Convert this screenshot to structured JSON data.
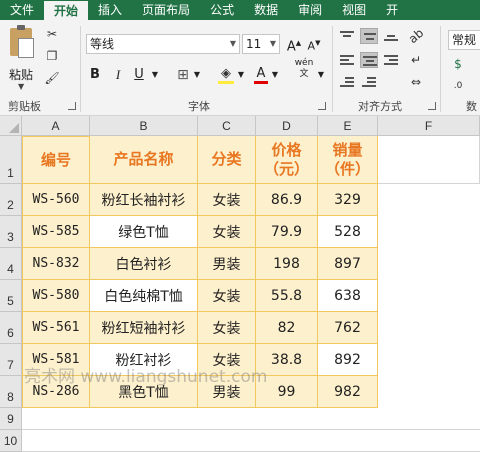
{
  "ribbon_tabs": [
    "文件",
    "开始",
    "插入",
    "页面布局",
    "公式",
    "数据",
    "审阅",
    "视图",
    "开"
  ],
  "active_tab": 1,
  "clipboard": {
    "paste_label": "粘贴",
    "group_label": "剪贴板"
  },
  "font": {
    "name": "等线",
    "size": "11",
    "group_label": "字体",
    "bold": "B",
    "italic": "I",
    "underline": "U",
    "wen": "wén\n文"
  },
  "alignment": {
    "group_label": "对齐方式"
  },
  "number": {
    "format": "常规",
    "group_label": "数"
  },
  "columns": [
    "A",
    "B",
    "C",
    "D",
    "E",
    "F"
  ],
  "rows": [
    "1",
    "2",
    "3",
    "4",
    "5",
    "6",
    "7",
    "8",
    "9",
    "10"
  ],
  "table": {
    "headers": [
      "编号",
      "产品名称",
      "分类",
      "价格\n（元）",
      "销量\n（件）"
    ],
    "data": [
      [
        "WS-560",
        "粉红长袖衬衫",
        "女装",
        "86.9",
        "329"
      ],
      [
        "WS-585",
        "绿色T恤",
        "女装",
        "79.9",
        "528"
      ],
      [
        "NS-832",
        "白色衬衫",
        "男装",
        "198",
        "897"
      ],
      [
        "WS-580",
        "白色纯棉T恤",
        "女装",
        "55.8",
        "638"
      ],
      [
        "WS-561",
        "粉红短袖衬衫",
        "女装",
        "82",
        "762"
      ],
      [
        "WS-581",
        "粉红衬衫",
        "女装",
        "38.8",
        "892"
      ],
      [
        "NS-286",
        "黑色T恤",
        "男装",
        "99",
        "982"
      ]
    ]
  },
  "watermark": "亮术网 www.liangshunet.com",
  "colors": {
    "ribbon_green": "#217346",
    "header_text": "#e87722",
    "highlight_fill": "#fdf0cc",
    "table_border": "#f1c860"
  }
}
